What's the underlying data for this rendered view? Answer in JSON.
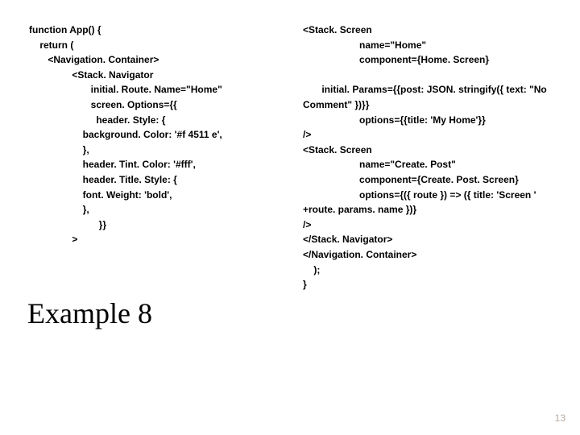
{
  "left_code": "function App() {\n    return (\n       <Navigation. Container>\n                <Stack. Navigator\n                       initial. Route. Name=\"Home\"\n                       screen. Options={{\n                         header. Style: {\n                    background. Color: '#f 4511 e',\n                    },\n                    header. Tint. Color: '#fff',\n                    header. Title. Style: {\n                    font. Weight: 'bold',\n                    },\n                          }}\n                >",
  "right_code": "<Stack. Screen\n                     name=\"Home\"\n                     component={Home. Screen}\n\n       initial. Params={{post: JSON. stringify({ text: \"No Comment\" })}}\n                     options={{title: 'My Home'}}\n/>\n<Stack. Screen\n                     name=\"Create. Post\"\n                     component={Create. Post. Screen}\n                     options={({ route }) => ({ title: 'Screen ' +route. params. name })}\n/>\n</Stack. Navigator>\n</Navigation. Container>\n    );\n}",
  "heading": "Example 8",
  "page_number": "13"
}
